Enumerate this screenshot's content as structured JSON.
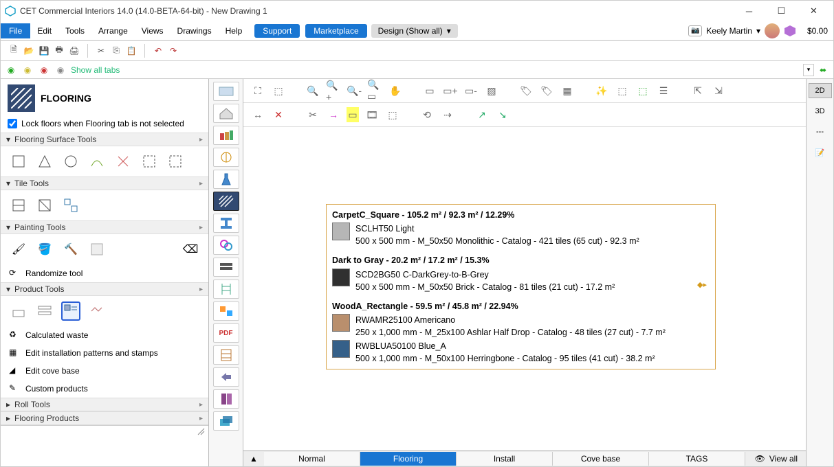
{
  "window": {
    "title": "CET Commercial Interiors 14.0 (14.0-BETA-64-bit) - New Drawing 1"
  },
  "menu": {
    "file": "File",
    "edit": "Edit",
    "tools": "Tools",
    "arrange": "Arrange",
    "views": "Views",
    "drawings": "Drawings",
    "help": "Help",
    "support": "Support",
    "marketplace": "Marketplace",
    "design": "Design (Show all)",
    "user": "Keely Martin",
    "price": "$0.00"
  },
  "toolstrip": {
    "showtabs": "Show all tabs"
  },
  "sidebar": {
    "header": "FLOORING",
    "lock_label": "Lock floors when Flooring tab is not selected",
    "sections": {
      "surface": "Flooring Surface Tools",
      "tile": "Tile Tools",
      "painting": "Painting Tools",
      "product": "Product Tools",
      "roll": "Roll Tools",
      "flooring_products": "Flooring Products"
    },
    "links": {
      "randomize": "Randomize tool",
      "waste": "Calculated waste",
      "patterns": "Edit installation patterns and stamps",
      "covebase": "Edit cove base",
      "custom": "Custom products"
    }
  },
  "legend": {
    "g1": {
      "title": "CarpetC_Square - 105.2 m² / 92.3 m² / 12.29%",
      "name": "SCLHT50 Light",
      "detail": "500 x 500 mm - M_50x50 Monolithic - Catalog - 421 tiles (65 cut) - 92.3 m²",
      "color": "#b6b6b6"
    },
    "g2": {
      "title": "Dark to Gray - 20.2 m² / 17.2 m² / 15.3%",
      "name": "SCD2BG50 C-DarkGrey-to-B-Grey",
      "detail": "500 x 500 mm - M_50x50 Brick - Catalog - 81 tiles (21 cut) - 17.2 m²",
      "color": "#303030"
    },
    "g3": {
      "title": "WoodA_Rectangle - 59.5 m² / 45.8 m² / 22.94%",
      "r1_name": "RWAMR25100 Americano",
      "r1_detail": "250 x 1,000 mm - M_25x100 Ashlar Half Drop - Catalog - 48 tiles (27 cut) - 7.7 m²",
      "r1_color": "#b98f6d",
      "r2_name": "RWBLUA50100 Blue_A",
      "r2_detail": "500 x 1,000 mm - M_50x100 Herringbone - Catalog - 95 tiles (41 cut) - 38.2 m²",
      "r2_color": "#356089"
    }
  },
  "rightrail": {
    "mode2d": "2D",
    "mode3d": "3D"
  },
  "bottomtabs": {
    "normal": "Normal",
    "flooring": "Flooring",
    "install": "Install",
    "covebase": "Cove base",
    "tags": "TAGS",
    "viewall": "View all"
  }
}
